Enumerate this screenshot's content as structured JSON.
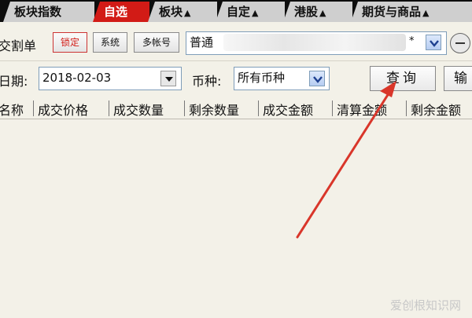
{
  "tabs": [
    {
      "label": "板块指数",
      "arrow": ""
    },
    {
      "label": "自选",
      "arrow": ""
    },
    {
      "label": "板块",
      "arrow": "▲"
    },
    {
      "label": "自定",
      "arrow": "▲"
    },
    {
      "label": "港股",
      "arrow": "▲"
    },
    {
      "label": "期货与商品",
      "arrow": "▲"
    }
  ],
  "toolbar": {
    "title": "交割单",
    "lock_label": "锁定",
    "system_label": "系统",
    "multi_account_label": "多帐号",
    "account_value": "普通",
    "account_tail": "*"
  },
  "filter": {
    "date_label": "日期:",
    "date_value": "2018-02-03",
    "currency_label": "币种:",
    "currency_value": "所有币种",
    "query_label": "查询",
    "output_label": "输"
  },
  "table": {
    "columns": [
      "名称",
      "成交价格",
      "成交数量",
      "剩余数量",
      "成交金额",
      "清算金额",
      "剩余金额"
    ]
  },
  "watermark": "爱创根知识网",
  "colors": {
    "active_tab": "#d21b16",
    "annotation_arrow": "#d9362a"
  }
}
